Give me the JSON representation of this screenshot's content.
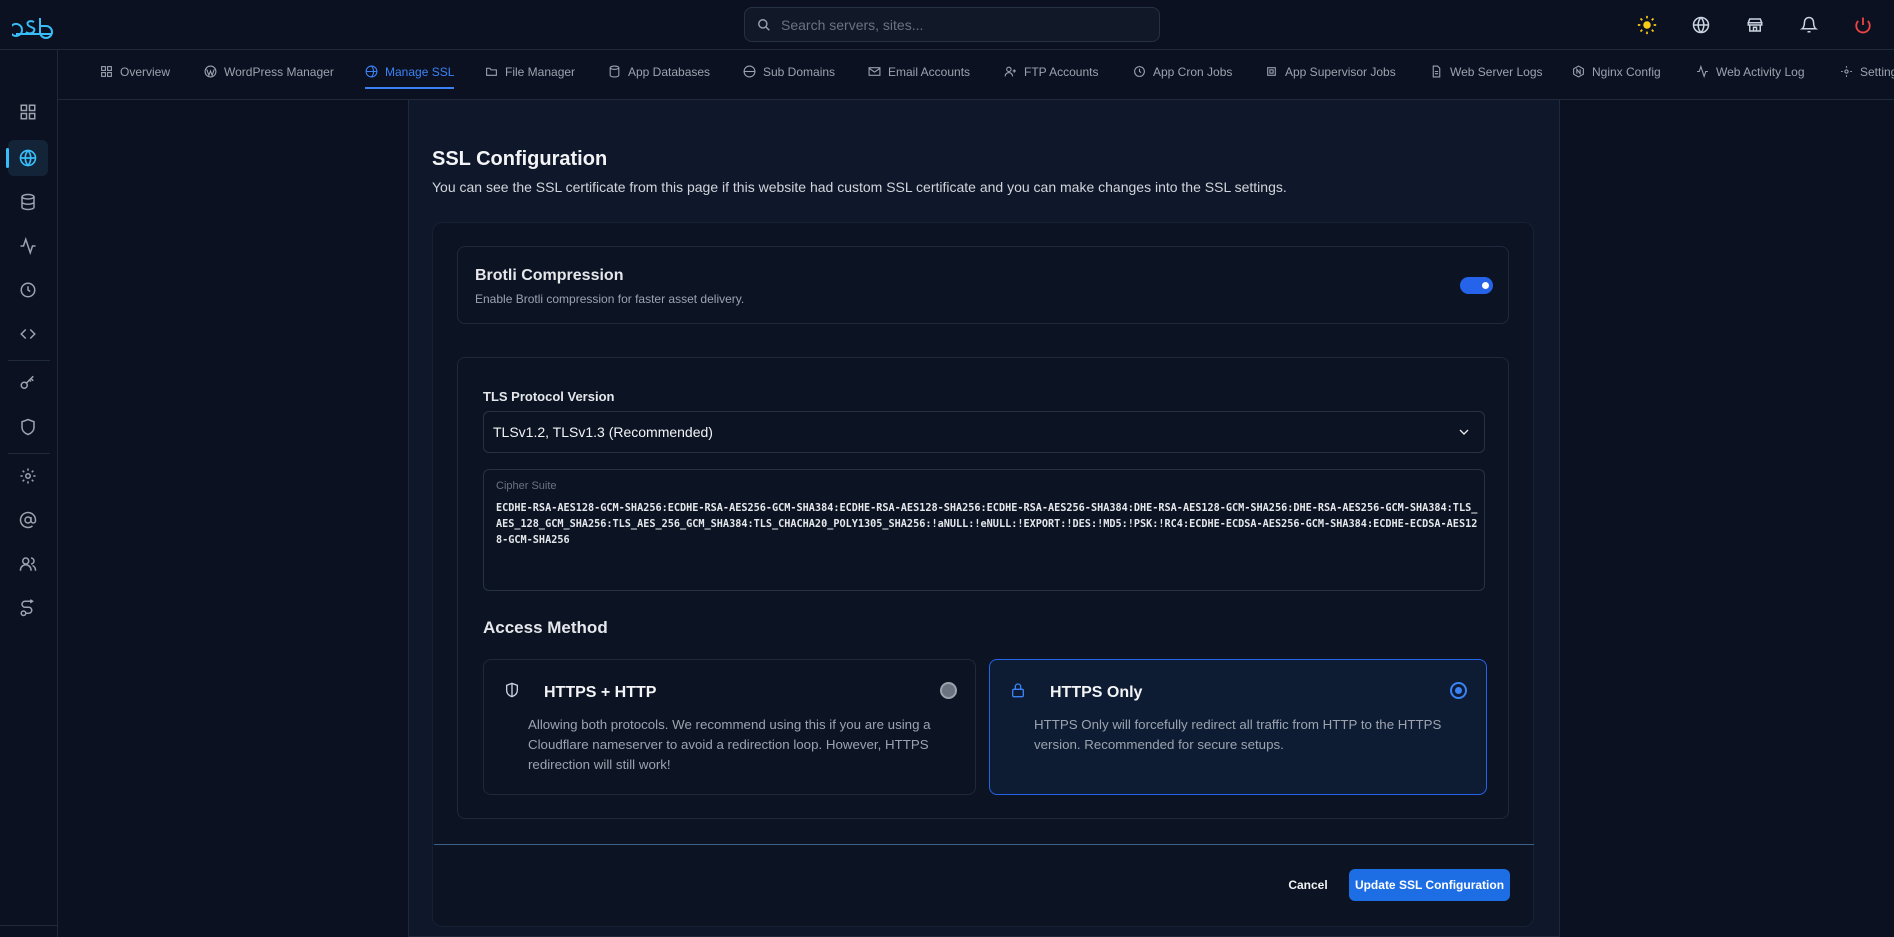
{
  "topbar": {
    "search_placeholder": "Search servers, sites...",
    "icons": [
      "sun-icon",
      "globe-icon",
      "store-icon",
      "bell-icon",
      "power-icon"
    ]
  },
  "tabs": [
    {
      "label": "Overview",
      "icon": "grid-icon"
    },
    {
      "label": "WordPress Manager",
      "icon": "wordpress-icon"
    },
    {
      "label": "Manage SSL",
      "icon": "ssl-icon",
      "active": true
    },
    {
      "label": "File Manager",
      "icon": "folder-icon"
    },
    {
      "label": "App Databases",
      "icon": "database-icon"
    },
    {
      "label": "Sub Domains",
      "icon": "globe-icon"
    },
    {
      "label": "Email Accounts",
      "icon": "mail-icon"
    },
    {
      "label": "FTP Accounts",
      "icon": "user-plus-icon"
    },
    {
      "label": "App Cron Jobs",
      "icon": "clock-icon"
    },
    {
      "label": "App Supervisor Jobs",
      "icon": "cpu-icon"
    },
    {
      "label": "Web Server Logs",
      "icon": "file-icon"
    },
    {
      "label": "Nginx Config",
      "icon": "nginx-icon"
    },
    {
      "label": "Web Activity Log",
      "icon": "activity-icon"
    },
    {
      "label": "Settings",
      "icon": "gear-icon"
    }
  ],
  "page": {
    "title": "SSL Configuration",
    "description": "You can see the SSL certificate from this page if this website had custom SSL certificate and you can make changes into the SSL settings."
  },
  "brotli": {
    "title": "Brotli Compression",
    "description": "Enable Brotli compression for faster asset delivery.",
    "enabled": true
  },
  "tls": {
    "label": "TLS Protocol Version",
    "selected": "TLSv1.2, TLSv1.3 (Recommended)"
  },
  "cipher": {
    "label": "Cipher Suite",
    "value": "ECDHE-RSA-AES128-GCM-SHA256:ECDHE-RSA-AES256-GCM-SHA384:ECDHE-RSA-AES128-SHA256:ECDHE-RSA-AES256-SHA384:DHE-RSA-AES128-GCM-SHA256:DHE-RSA-AES256-GCM-SHA384:TLS_AES_128_GCM_SHA256:TLS_AES_256_GCM_SHA384:TLS_CHACHA20_POLY1305_SHA256:!aNULL:!eNULL:!EXPORT:!DES:!MD5:!PSK:!RC4:ECDHE-ECDSA-AES256-GCM-SHA384:ECDHE-ECDSA-AES128-GCM-SHA256"
  },
  "access": {
    "title": "Access Method",
    "options": [
      {
        "title": "HTTPS + HTTP",
        "description": "Allowing both protocols. We recommend using this if you are using a Cloudflare nameserver to avoid a redirection loop. However, HTTPS redirection will still work!",
        "selected": false
      },
      {
        "title": "HTTPS Only",
        "description": "HTTPS Only will forcefully redirect all traffic from HTTP to the HTTPS version. Recommended for secure setups.",
        "selected": true
      }
    ]
  },
  "actions": {
    "cancel": "Cancel",
    "update": "Update SSL Configuration"
  },
  "colors": {
    "accent": "#2563eb",
    "background": "#0b1120",
    "power": "#ef4444",
    "sun": "#facc15"
  }
}
